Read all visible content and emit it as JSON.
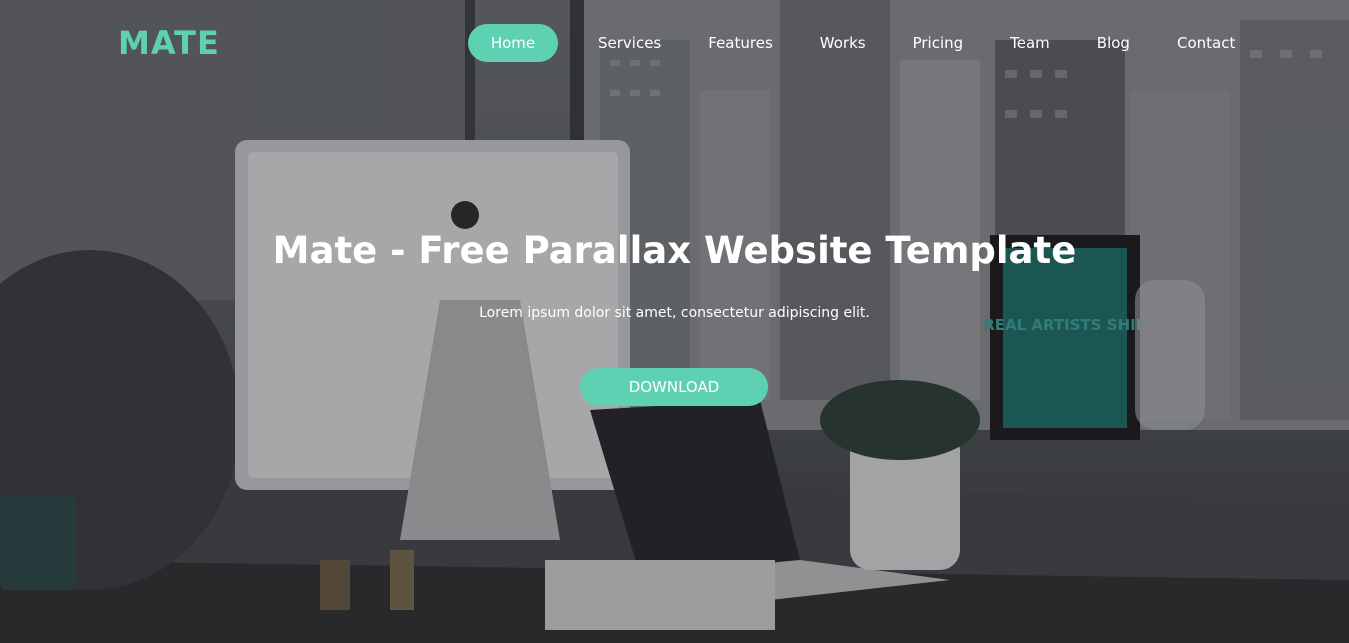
{
  "brand": {
    "logo_text": "MATE",
    "accent_color": "#5ed1b2"
  },
  "nav": {
    "items": [
      {
        "label": "Home",
        "active": true
      },
      {
        "label": "Services",
        "active": false
      },
      {
        "label": "Features",
        "active": false
      },
      {
        "label": "Works",
        "active": false
      },
      {
        "label": "Pricing",
        "active": false
      },
      {
        "label": "Team",
        "active": false
      },
      {
        "label": "Blog",
        "active": false
      },
      {
        "label": "Contact",
        "active": false
      }
    ]
  },
  "hero": {
    "title": "Mate - Free Parallax Website Template",
    "subtitle": "Lorem ipsum dolor sit amet, consectetur adipiscing elit.",
    "cta_label": "DOWNLOAD"
  },
  "background_poster_text": "REAL ARTISTS SHIP"
}
